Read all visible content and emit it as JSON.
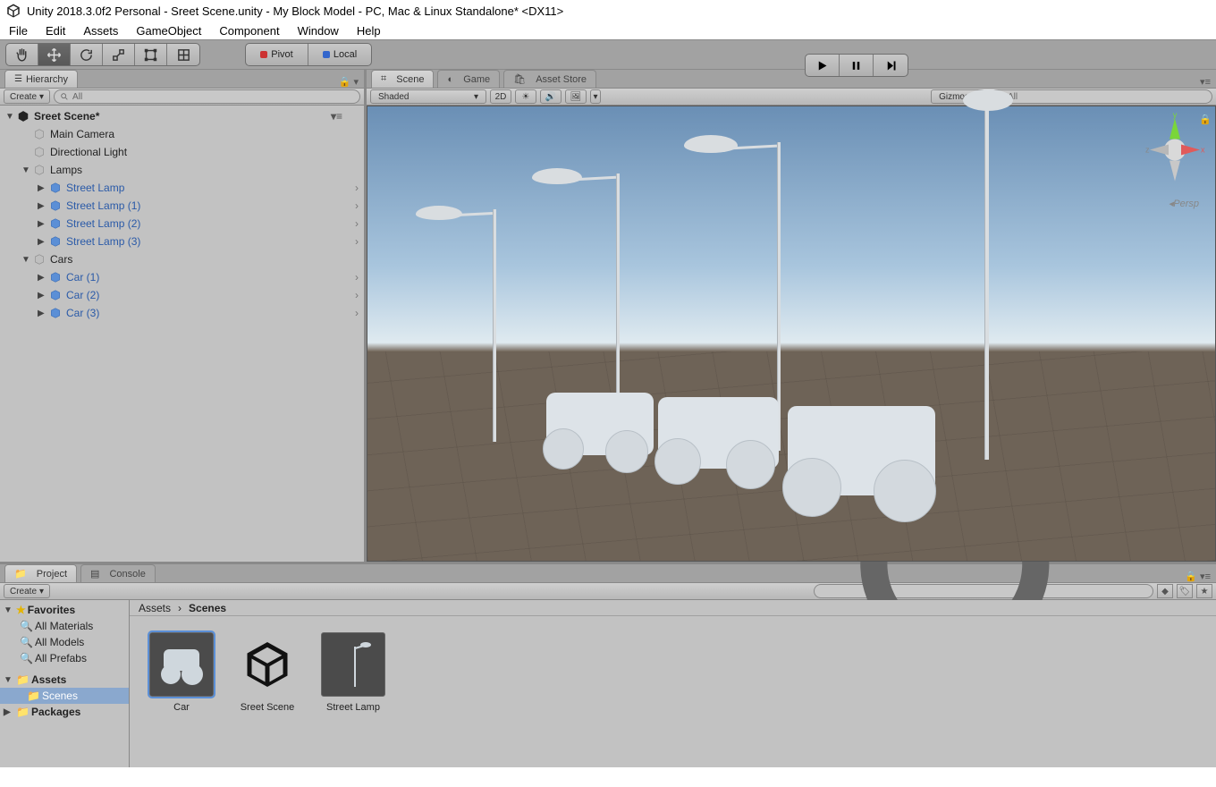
{
  "window": {
    "title": "Unity 2018.3.0f2 Personal - Sreet Scene.unity - My Block Model - PC, Mac & Linux Standalone* <DX11>"
  },
  "menu": [
    "File",
    "Edit",
    "Assets",
    "GameObject",
    "Component",
    "Window",
    "Help"
  ],
  "toolbar": {
    "tools": [
      "hand",
      "move",
      "rotate",
      "scale",
      "rect",
      "transform"
    ],
    "active_tool_index": 1,
    "pivot": "Pivot",
    "local": "Local"
  },
  "hierarchy": {
    "tab": "Hierarchy",
    "create": "Create",
    "search_placeholder": "All",
    "scene": "Sreet Scene*",
    "items": [
      {
        "label": "Main Camera",
        "type": "go",
        "indent": 1,
        "foldout": "",
        "prefab": false
      },
      {
        "label": "Directional Light",
        "type": "go",
        "indent": 1,
        "foldout": "",
        "prefab": false
      },
      {
        "label": "Lamps",
        "type": "go",
        "indent": 1,
        "foldout": "▼",
        "prefab": false
      },
      {
        "label": "Street Lamp",
        "type": "prefab",
        "indent": 2,
        "foldout": "▶",
        "prefab": true,
        "chev": true
      },
      {
        "label": "Street Lamp (1)",
        "type": "prefab",
        "indent": 2,
        "foldout": "▶",
        "prefab": true,
        "chev": true
      },
      {
        "label": "Street Lamp (2)",
        "type": "prefab",
        "indent": 2,
        "foldout": "▶",
        "prefab": true,
        "chev": true
      },
      {
        "label": "Street Lamp (3)",
        "type": "prefab",
        "indent": 2,
        "foldout": "▶",
        "prefab": true,
        "chev": true
      },
      {
        "label": "Cars",
        "type": "go",
        "indent": 1,
        "foldout": "▼",
        "prefab": false
      },
      {
        "label": "Car (1)",
        "type": "prefab",
        "indent": 2,
        "foldout": "▶",
        "prefab": true,
        "chev": true
      },
      {
        "label": "Car (2)",
        "type": "prefab",
        "indent": 2,
        "foldout": "▶",
        "prefab": true,
        "chev": true
      },
      {
        "label": "Car (3)",
        "type": "prefab",
        "indent": 2,
        "foldout": "▶",
        "prefab": true,
        "chev": true
      }
    ]
  },
  "scene": {
    "tabs": [
      "Scene",
      "Game",
      "Asset Store"
    ],
    "shading": "Shaded",
    "btn_2d": "2D",
    "gizmos": "Gizmos",
    "search_placeholder": "All",
    "persp": "Persp",
    "axes": {
      "x": "x",
      "y": "y",
      "z": "z"
    }
  },
  "project": {
    "tabs": [
      "Project",
      "Console"
    ],
    "create": "Create",
    "search_placeholder": "",
    "tree": {
      "favorites": "Favorites",
      "fav_items": [
        "All Materials",
        "All Models",
        "All Prefabs"
      ],
      "assets": "Assets",
      "assets_items": [
        "Scenes"
      ],
      "packages": "Packages"
    },
    "breadcrumb": [
      "Assets",
      "Scenes"
    ],
    "assets": [
      {
        "name": "Car",
        "kind": "prefab-car"
      },
      {
        "name": "Sreet Scene",
        "kind": "scene"
      },
      {
        "name": "Street Lamp",
        "kind": "prefab-lamp"
      }
    ]
  }
}
